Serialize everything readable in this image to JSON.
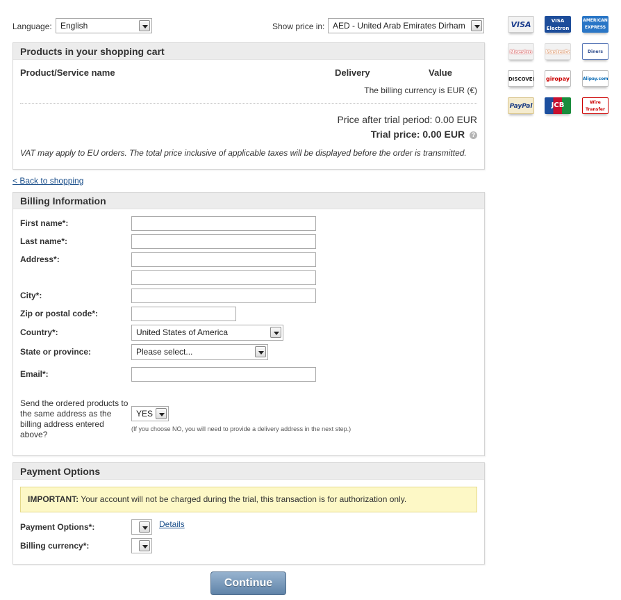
{
  "top": {
    "language_label": "Language:",
    "language_value": "English",
    "price_label": "Show price in:",
    "price_value": "AED - United Arab Emirates Dirham"
  },
  "cart": {
    "title": "Products in your shopping cart",
    "col_product": "Product/Service name",
    "col_delivery": "Delivery",
    "col_value": "Value",
    "billing_currency_note": "The billing currency is EUR (€)",
    "price_after_trial": "Price after trial period: 0.00 EUR",
    "trial_price": "Trial price: 0.00 EUR",
    "help_icon": "question-circle-icon",
    "vat_note": "VAT may apply to EU orders. The total price inclusive of applicable taxes will be displayed before the order is transmitted."
  },
  "back_link": "< Back to shopping",
  "billing": {
    "title": "Billing Information",
    "first_name_label": "First name*:",
    "last_name_label": "Last name*:",
    "address_label": "Address*:",
    "city_label": "City*:",
    "zip_label": "Zip or postal code*:",
    "country_label": "Country*:",
    "country_value": "United States of America",
    "state_label": "State or province:",
    "state_value": "Please select...",
    "email_label": "Email*:",
    "same_address_label": "Send the ordered products to the same address as the billing address entered above?",
    "same_address_value": "YES",
    "same_address_hint": "(If you choose NO, you will need to provide a delivery address in the next step.)"
  },
  "payment": {
    "title": "Payment Options",
    "important_label": "IMPORTANT:",
    "important_text": " Your account will not be charged during the trial, this transaction is for authorization only.",
    "options_label": "Payment Options*:",
    "details_link": "Details",
    "currency_label": "Billing currency*:"
  },
  "continue_label": "Continue",
  "cards": [
    {
      "name": "visa-card-icon",
      "text": "VISA"
    },
    {
      "name": "visa-electron-card-icon",
      "text": "VISA Electron"
    },
    {
      "name": "american-express-card-icon",
      "text": "AMERICAN EXPRESS"
    },
    {
      "name": "maestro-card-icon",
      "text": "Maestro"
    },
    {
      "name": "mastercard-card-icon",
      "text": "MasterCard"
    },
    {
      "name": "diners-club-card-icon",
      "text": "Diners Club"
    },
    {
      "name": "discover-card-icon",
      "text": "DISCOVER"
    },
    {
      "name": "giropay-card-icon",
      "text": "giropay"
    },
    {
      "name": "alipay-card-icon",
      "text": "Alipay.com"
    },
    {
      "name": "paypal-card-icon",
      "text": "PayPal"
    },
    {
      "name": "jcb-card-icon",
      "text": "JCB"
    },
    {
      "name": "wire-transfer-card-icon",
      "text": "Wire Transfer"
    }
  ]
}
